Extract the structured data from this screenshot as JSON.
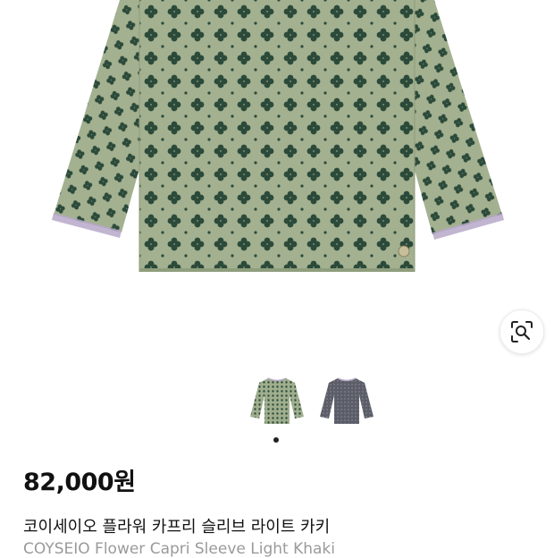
{
  "product": {
    "image_alt": "product-shirt-khaki",
    "price": "82,000원",
    "title_ko": "코이세이오 플라워 카프리 슬리브 라이트 카키",
    "title_en": "COYSEIO Flower Capri Sleeve Light Khaki"
  },
  "gallery": {
    "variants": [
      "light-khaki",
      "grey"
    ],
    "active_index": 0
  },
  "colors": {
    "khaki": "#9fae8d",
    "pattern": "#2c4a3a",
    "grey": "#5b5e68",
    "trim": "#b7a8c9"
  }
}
